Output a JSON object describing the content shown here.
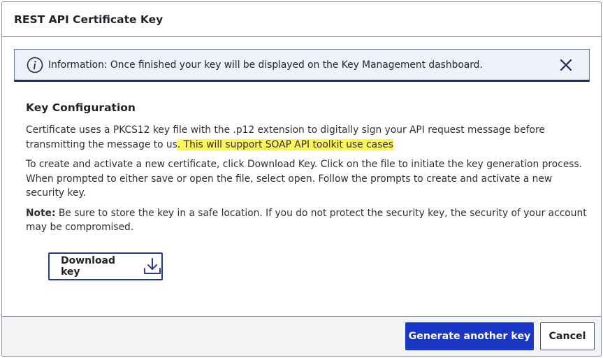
{
  "dialog": {
    "title": "REST API Certificate Key"
  },
  "info_banner": {
    "text": "Information: Once finished your key will be displayed on the Key Management dashboard.",
    "icon": "info-icon",
    "close_icon": "close-icon"
  },
  "content": {
    "section_title": "Key Configuration",
    "para1_text": "Certificate uses a PKCS12 key file with the .p12 extension to digitally sign your API request message before transmitting the message to us",
    "para1_highlight": ". This will support SOAP API toolkit use cases",
    "para2": "To create and activate a new certificate, click Download Key. Click on the file to initiate the key generation process. When prompted to either save or open the file, select open. Follow the prompts to create and activate a new security key.",
    "note_label": "Note:",
    "note_text": " Be sure to store the key in a safe location. If you do not protect the security key, the security of your account may be compromised."
  },
  "download_button": {
    "label": "Download key",
    "icon": "download-icon"
  },
  "footer": {
    "primary_label": "Generate another key",
    "secondary_label": "Cancel"
  },
  "colors": {
    "primary": "#1b35c4",
    "banner_bg": "#eef1f8",
    "banner_accent": "#1d2b57",
    "highlight": "#fdf55c"
  }
}
